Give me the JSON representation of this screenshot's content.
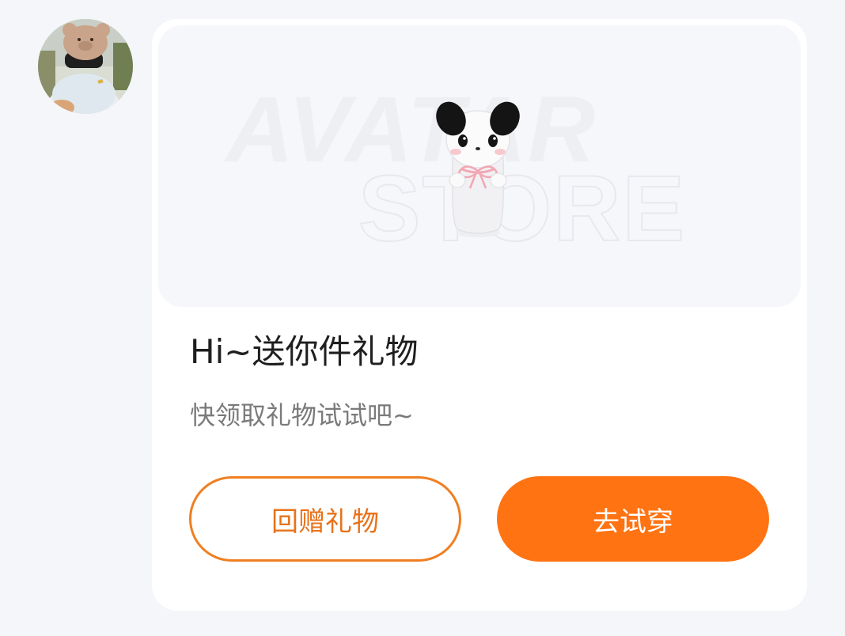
{
  "message": {
    "sender_avatar": "user-avatar-photo",
    "banner": {
      "watermark_line1": "AVATAR",
      "watermark_line2": "STORE",
      "gift_icon": "panda-plush-icon"
    },
    "title": "Hi~送你件礼物",
    "subtitle": "快领取礼物试试吧~",
    "buttons": {
      "return_gift": "回赠礼物",
      "try_on": "去试穿"
    }
  },
  "colors": {
    "page_bg": "#f4f6f9",
    "card_bg": "#ffffff",
    "banner_bg": "#f6f7fa",
    "accent": "#ff7312",
    "accent_text": "#e8721a"
  }
}
